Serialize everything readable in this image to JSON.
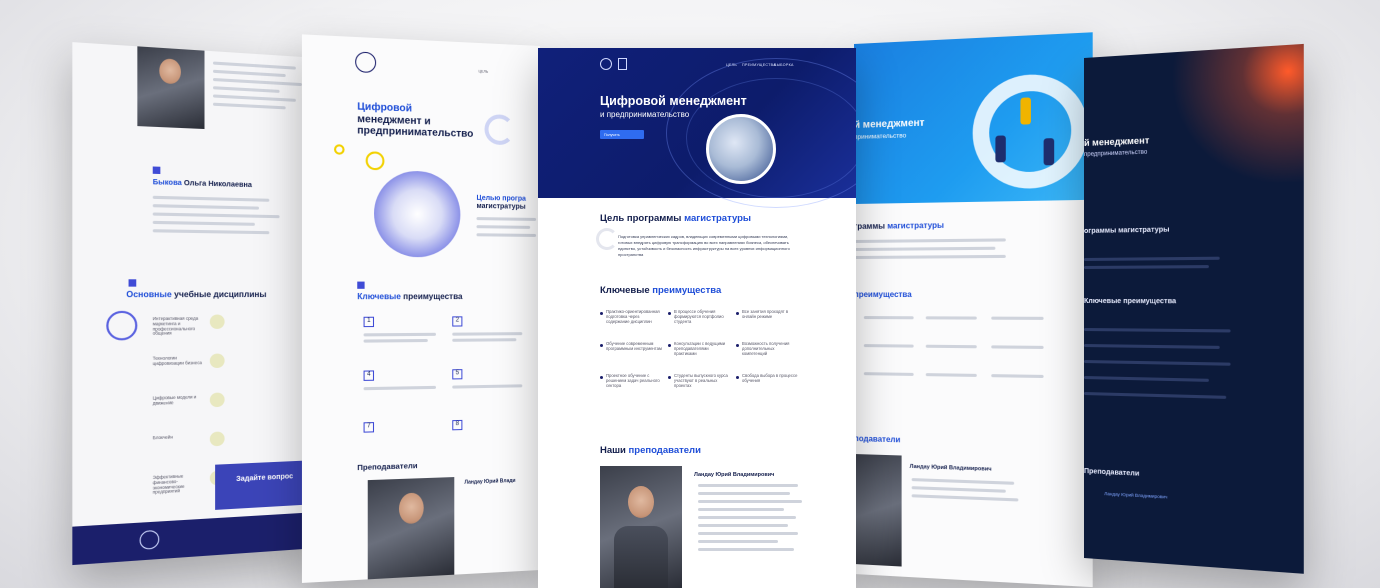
{
  "center": {
    "nav": [
      "ЦЕЛЬ",
      "ПРЕИМУЩЕСТВА",
      "ВЫБОРКА"
    ],
    "hero_title": "Цифровой менеджмент",
    "hero_subtitle": "и предпринимательство",
    "hero_button": "Получить",
    "goal_title_prefix": "Цель программы",
    "goal_title_accent": "магистратуры",
    "goal_text": "Подготовка управленческих кадров, владеющих современными цифровыми технологиями, готовых внедрять цифровую трансформацию во всех направлениях бизнеса, обеспечивать единство, устойчивость и безопасность инфраструктуры на всех уровнях информационного пространства",
    "adv_title_prefix": "Ключевые",
    "adv_title_accent": "преимущества",
    "adv_items": [
      "Практико-ориентированная подготовка через содержание дисциплин",
      "В процессе обучения формируются портфолио студента",
      "Все занятия проходят в онлайн режиме",
      "Обучение современным программным инструментам",
      "Консультации с ведущими преподавателями практиками",
      "Возможность получения дополнительных компетенций",
      "Проектное обучение с решением задач реального сектора",
      "Студенты выпускного курса участвуют в реальных проектах",
      "Свобода выбора в процессе обучения"
    ],
    "teachers_title_prefix": "Наши",
    "teachers_title_accent": "преподаватели",
    "teacher_name": "Ландау Юрий Владимирович"
  },
  "page2": {
    "title_line1": "Цифровой",
    "title_line2": "менеджмент и",
    "title_line3": "предпринимательство",
    "goal_accent": "Целью програ",
    "goal_rest": "магистратуры",
    "adv_accent": "Ключевые",
    "adv_rest": "преимущества",
    "numbers": [
      "1",
      "2",
      "4",
      "5",
      "7",
      "8"
    ],
    "teachers": "Преподаватели",
    "teacher_name": "Ландау Юрий Влади"
  },
  "page1": {
    "name_accent": "Быкова",
    "name_rest": "Ольга Николаевна",
    "disciplines_accent": "Основные",
    "disciplines_rest": "учебные дисциплины",
    "disciplines": [
      "Интерактивная среда маркетинга и профессионального общения",
      "Технологии цифровизации бизнеса",
      "Цифровые модели и движение",
      "Блокчейн",
      "Эффективные финансово-экономические предприятий"
    ],
    "ask_title": "Задайте вопрос"
  },
  "page4": {
    "hero_title": "й менеджмент",
    "hero_sub": "принимательство",
    "goal_accent": "граммы",
    "goal_rest": "магистратуры",
    "adv_accent": "преимущества",
    "teachers": "подаватели",
    "teacher_name": "Ландау Юрий Владимирович"
  },
  "page5": {
    "hero_title": "й менеджмент",
    "hero_sub": "предпринимательство",
    "goal": "ограммы магистратуры",
    "adv": "Ключевые преимущества",
    "teachers": "Преподаватели",
    "teacher_name": "Ландау Юрий Владимирович"
  },
  "colors": {
    "navy": "#141f4d",
    "accent_blue": "#1f4ed8",
    "hero_navy": "#10207a",
    "hero_blue": "#1e9cf0",
    "dark_bg": "#0c1a3a",
    "orange_glow": "#ff5a2a"
  }
}
